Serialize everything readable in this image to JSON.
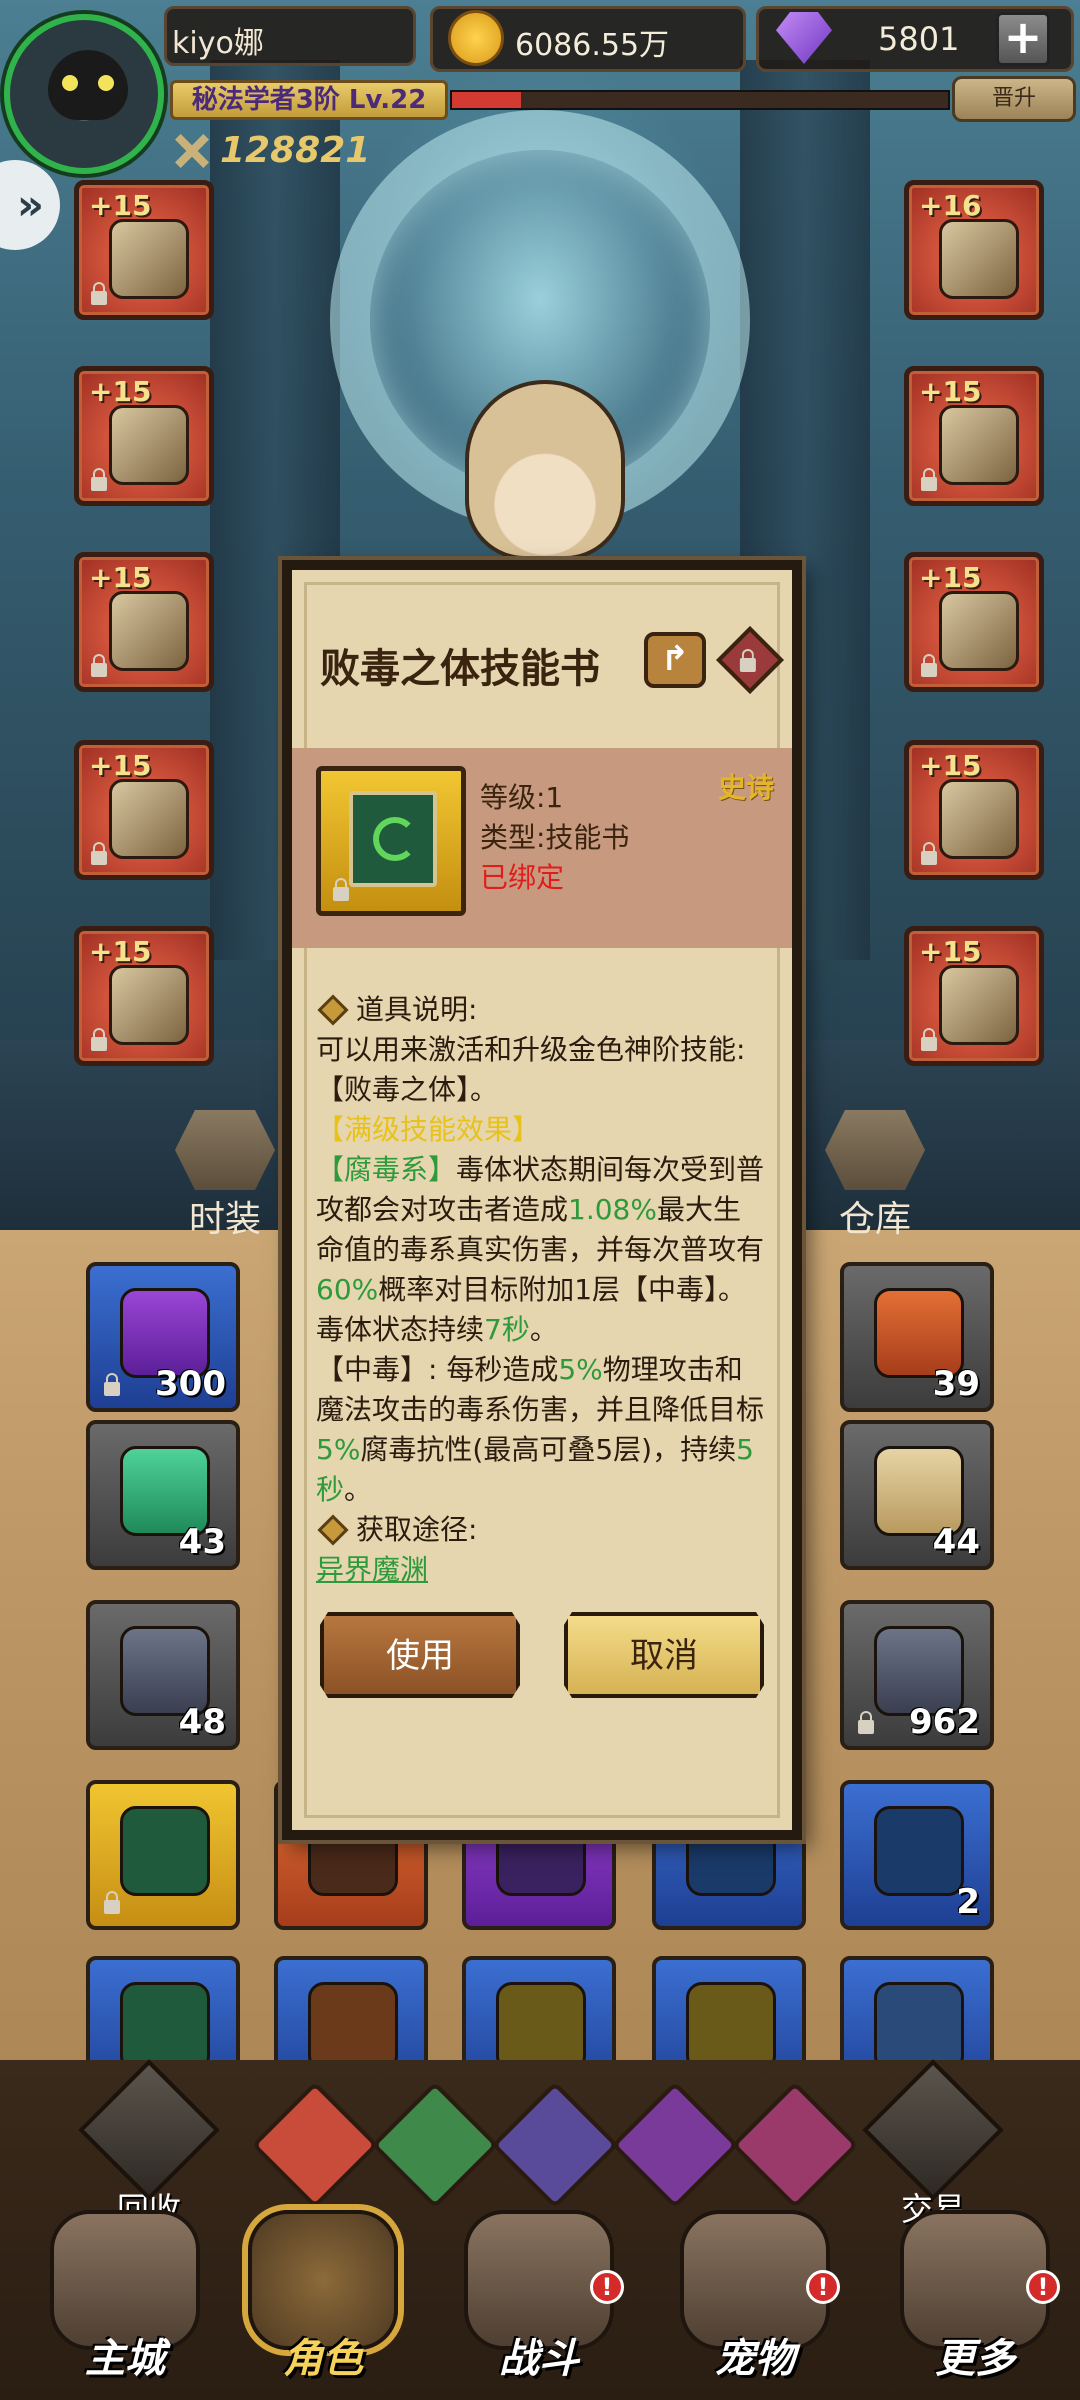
{
  "hud": {
    "player_name": "kiyo娜",
    "title": "秘法学者3阶 Lv.22",
    "combat_power": "128821",
    "gold": "6086.55万",
    "gems": "5801",
    "promote_label": "晋升",
    "exp_fraction": 0.14
  },
  "equipment": {
    "left": [
      "+15",
      "+15",
      "+15",
      "+15",
      "+15"
    ],
    "right": [
      "+16",
      "+15",
      "+15",
      "+15",
      "+15"
    ]
  },
  "tabs": {
    "fashion": "时装",
    "warehouse": "仓库"
  },
  "inventory": {
    "counts": [
      "300",
      "39",
      "43",
      "44",
      "48",
      "962",
      "2"
    ]
  },
  "categories": {
    "recycle": "回收",
    "trade": "交易"
  },
  "nav": {
    "main_city": "主城",
    "character": "角色",
    "battle": "战斗",
    "pet": "宠物",
    "more": "更多",
    "badge": "!"
  },
  "dialog": {
    "title": "败毒之体技能书",
    "level": "等级:1",
    "type": "类型:技能书",
    "bound": "已绑定",
    "rarity": "史诗",
    "desc_header": "道具说明:",
    "desc_line1": "可以用来激活和升级金色神阶技能:",
    "desc_line2": "【败毒之体】。",
    "max_effect": "【满级技能效果】",
    "effect_tag": "【腐毒系】",
    "effect_a": "毒体状态期间每次受到普攻都会对攻击者造成",
    "effect_pct1": "1.08%",
    "effect_b": "最大生命值的毒系真实伤害，并每次普攻有",
    "effect_pct2": "60%",
    "effect_c": "概率对目标附加1层【中毒】。毒体状态持续",
    "effect_dur": "7秒",
    "effect_d": "。",
    "poison_a": "【中毒】: 每秒造成",
    "poison_pct": "5%",
    "poison_b": "物理攻击和魔法攻击的毒系伤害，并且降低目标",
    "poison_pct2": "5%",
    "poison_c": "腐毒抗性(最高可叠5层)，持续",
    "poison_dur": "5秒",
    "poison_d": "。",
    "source_header": "获取途径:",
    "source_link": "异界魔渊",
    "use_button": "使用",
    "cancel_button": "取消"
  },
  "colors": {
    "bound": "#e01d1d",
    "rarity_gold": "#e5b52a",
    "highlight_green": "#2e9a3c",
    "highlight_yellow": "#e8c21a"
  }
}
